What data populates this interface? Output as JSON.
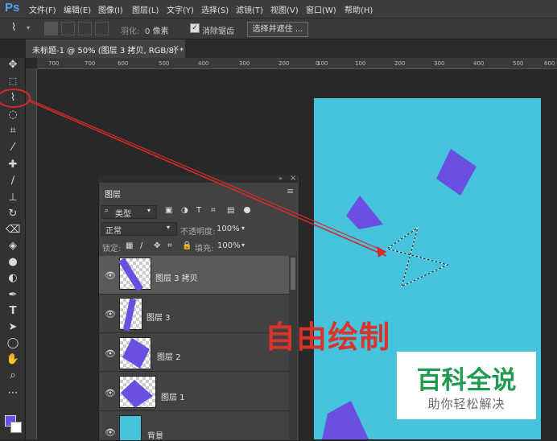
{
  "app": {
    "logo": "Ps"
  },
  "menu": {
    "items": [
      "文件(F)",
      "编辑(E)",
      "图像(I)",
      "图层(L)",
      "文字(Y)",
      "选择(S)",
      "滤镜(T)",
      "视图(V)",
      "窗口(W)",
      "帮助(H)"
    ]
  },
  "options": {
    "feather_label": "羽化:",
    "feather_value": "0 像素",
    "antialias_label": "消除锯齿",
    "select_mask_label": "选择并遮住 ..."
  },
  "document": {
    "tab_label": "未标题-1 @ 50% (图层 3 拷贝, RGB/8) *",
    "close_glyph": "×",
    "ruler_ticks": [
      "700",
      "600",
      "500",
      "400",
      "300",
      "200",
      "100",
      "0",
      "100",
      "200",
      "300",
      "400",
      "500",
      "600",
      "700"
    ]
  },
  "layers_panel": {
    "tab_label": "图层",
    "filter_kind": "类型",
    "blend_mode": "正常",
    "opacity_label": "不透明度:",
    "opacity_value": "100%",
    "lock_label": "锁定:",
    "fill_label": "填充:",
    "fill_value": "100%",
    "layers": [
      {
        "name": "图层 3 拷贝",
        "active": true
      },
      {
        "name": "图层 3",
        "active": false
      },
      {
        "name": "图层 2",
        "active": false
      },
      {
        "name": "图层 1",
        "active": false
      },
      {
        "name": "背景",
        "active": false
      }
    ]
  },
  "annotation": {
    "text": "自由绘制"
  },
  "watermark": {
    "title": "百科全说",
    "subtitle": "助你轻松解决"
  },
  "colors": {
    "canvas": "#45c2dc",
    "shape": "#6a4fe0",
    "annotation_red": "#d9342b",
    "watermark_green": "#1f9a4f"
  }
}
